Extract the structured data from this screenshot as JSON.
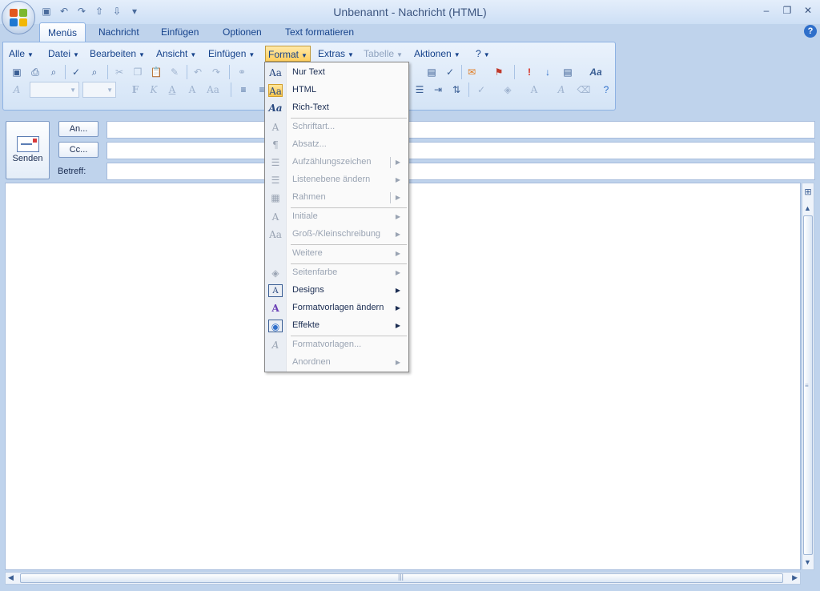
{
  "window": {
    "title": "Unbenannt - Nachricht (HTML)",
    "minimize": "–",
    "restore": "❐",
    "close": "✕"
  },
  "quick_access": {
    "save": "▣",
    "undo": "↶",
    "redo": "↷",
    "up": "⇧",
    "down": "⇩",
    "customize": "▾"
  },
  "tabs": [
    {
      "label": "Menüs",
      "active": true
    },
    {
      "label": "Nachricht"
    },
    {
      "label": "Einfügen"
    },
    {
      "label": "Optionen"
    },
    {
      "label": "Text formatieren"
    }
  ],
  "help": "?",
  "menubar": [
    {
      "label": "Alle"
    },
    {
      "label": "Datei"
    },
    {
      "label": "Bearbeiten"
    },
    {
      "label": "Ansicht"
    },
    {
      "label": "Einfügen"
    },
    {
      "label": "Format",
      "active": true
    },
    {
      "label": "Extras"
    },
    {
      "label": "Tabelle",
      "disabled": true
    },
    {
      "label": "Aktionen"
    },
    {
      "label": "?"
    }
  ],
  "toolbar_glyphs": {
    "bold": "F",
    "italic": "K",
    "underline": "A",
    "font_grow": "A",
    "case": "Aa",
    "styles": "A",
    "format": "Aa",
    "importance_high": "!",
    "importance_low": "↓"
  },
  "compose": {
    "send": "Senden",
    "to": "An...",
    "cc": "Cc...",
    "subject": "Betreff:"
  },
  "format_menu": {
    "items": [
      {
        "label": "Nur Text",
        "icon": "Aa"
      },
      {
        "label": "HTML",
        "icon": "Aa",
        "selected": true
      },
      {
        "label": "Rich-Text",
        "icon": "Aa"
      },
      {
        "label": "Schriftart...",
        "icon": "A",
        "disabled": true
      },
      {
        "label": "Absatz...",
        "icon": "¶",
        "disabled": true
      },
      {
        "label": "Aufzählungszeichen",
        "icon": "☰",
        "disabled": true,
        "submenu": true
      },
      {
        "label": "Listenebene ändern",
        "icon": "☰",
        "disabled": true,
        "submenu": true
      },
      {
        "label": "Rahmen",
        "icon": "▦",
        "disabled": true,
        "submenu": true
      },
      {
        "label": "Initiale",
        "icon": "A",
        "disabled": true,
        "submenu": true
      },
      {
        "label": "Groß-/Kleinschreibung",
        "icon": "Aa",
        "disabled": true,
        "submenu": true
      },
      {
        "label": "Weitere",
        "icon": "",
        "disabled": true,
        "submenu": true
      },
      {
        "label": "Seitenfarbe",
        "icon": "◈",
        "disabled": true,
        "submenu": true
      },
      {
        "label": "Designs",
        "icon": "A",
        "submenu": true
      },
      {
        "label": "Formatvorlagen ändern",
        "icon": "A",
        "submenu": true
      },
      {
        "label": "Effekte",
        "icon": "◉",
        "submenu": true
      },
      {
        "label": "Formatvorlagen...",
        "icon": "A",
        "disabled": true
      },
      {
        "label": "Anordnen",
        "icon": "",
        "disabled": true,
        "submenu": true
      }
    ]
  },
  "colors": {
    "accent": "#15428b",
    "highlight": "#ffc94b",
    "ribbon": "#d4e4f6"
  }
}
